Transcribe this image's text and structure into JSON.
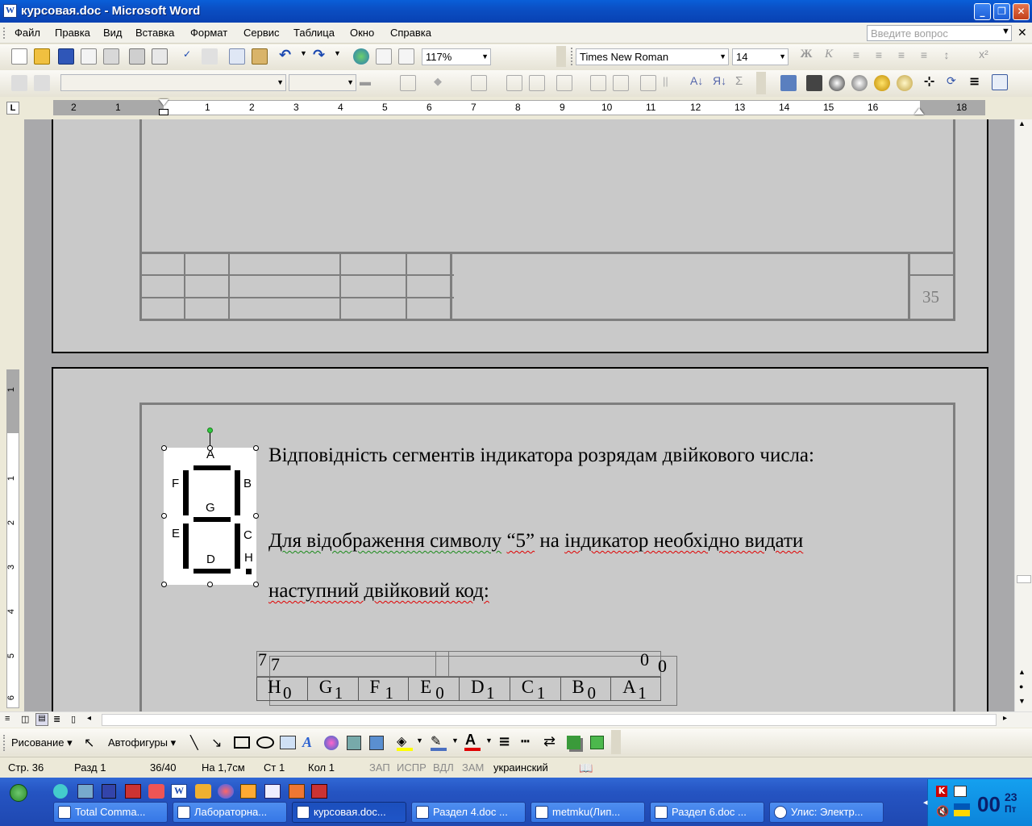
{
  "window": {
    "title": "курсовая.doc - Microsoft Word"
  },
  "menu": [
    "Файл",
    "Правка",
    "Вид",
    "Вставка",
    "Формат",
    "Сервис",
    "Таблица",
    "Окно",
    "Справка"
  ],
  "ask_placeholder": "Введите вопрос",
  "toolbar": {
    "zoom": "117%",
    "font": "Times New Roman",
    "size": "14"
  },
  "ruler": {
    "numbers": [
      "2",
      "1",
      "1",
      "2",
      "3",
      "4",
      "5",
      "6",
      "7",
      "8",
      "9",
      "10",
      "11",
      "12",
      "13",
      "14",
      "15",
      "16",
      "18"
    ]
  },
  "vruler": {
    "numbers": [
      "1",
      "1",
      "2",
      "3",
      "4",
      "5",
      "6"
    ]
  },
  "page1": {
    "page_number": "35"
  },
  "page2": {
    "line1": "Відповідність сегментів індикатора розрядам двійкового числа:",
    "line2_a": "Для відображення символу",
    "line2_b": "“5”",
    "line2_c": "на",
    "line2_d": "індикатор необхідно видати",
    "line3": "наступний двійковий код:",
    "segments": {
      "A": "A",
      "B": "B",
      "C": "C",
      "D": "D",
      "E": "E",
      "F": "F",
      "G": "G",
      "H": "H"
    },
    "table": {
      "top_left": "7",
      "top_right": "0",
      "ghost_left": "7",
      "ghost_right": "0",
      "cells": [
        {
          "letter": "H",
          "sub": "0"
        },
        {
          "letter": "G",
          "sub": "1"
        },
        {
          "letter": "F",
          "sub": "1"
        },
        {
          "letter": "E",
          "sub": "0"
        },
        {
          "letter": "D",
          "sub": "1"
        },
        {
          "letter": "C",
          "sub": "1"
        },
        {
          "letter": "B",
          "sub": "0"
        },
        {
          "letter": "A",
          "sub": "1"
        }
      ]
    }
  },
  "drawbar": {
    "draw": "Рисование",
    "autoshapes": "Автофигуры"
  },
  "status": {
    "page": "Стр. 36",
    "section": "Разд 1",
    "pages": "36/40",
    "at": "На 1,7см",
    "line": "Ст 1",
    "col": "Кол 1",
    "rec": "ЗАП",
    "trk": "ИСПР",
    "ext": "ВДЛ",
    "ovr": "ЗАМ",
    "lang": "украинский"
  },
  "taskbar": {
    "tasks": [
      "Total Comma...",
      "Лабораторна...",
      "курсовая.doc...",
      "Раздел 4.doc ...",
      "metmku(Лип...",
      "Раздел 6.doc ...",
      "Улис: Электр..."
    ],
    "clock": "00",
    "date_top": "23",
    "date_bottom": "Пт"
  }
}
